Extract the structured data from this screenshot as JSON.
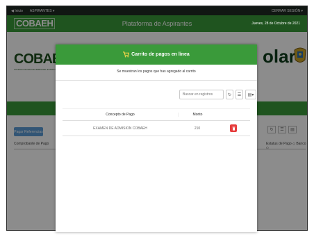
{
  "topbar": {
    "left_label": "◀ Inicio",
    "user_label": "ASPIRANTES ▾",
    "right_label": "CERRAR SESIÓN ▾"
  },
  "header": {
    "logo": "COBAEH",
    "title": "Plataforma de Aspirantes",
    "date": "Jueves, 28 de Octubre de 2021"
  },
  "banner": {
    "logo": "COBAEH",
    "logo_sub": "COLEGIO DE BACHILLERES DEL ESTADO DE HIDALGO",
    "right_text": "olar"
  },
  "background_page": {
    "pay_button": "Pagar Referencias",
    "column_left": "Comprobante de Pago",
    "column_right": "Estatus de Pago  ◇  Banco  ◇"
  },
  "modal": {
    "title": "Carrito de pagos en línea",
    "subtitle": "Se muestran los pagos que has agregado al carrito",
    "search_placeholder": "Buscar en registros",
    "columns": [
      "Concepto de Pago",
      "Monto"
    ],
    "rows": [
      {
        "concept": "EXAMEN DE ADMISION COBAEH",
        "amount": "210"
      }
    ]
  },
  "colors": {
    "brand_green": "#3a9a3a",
    "delete_red": "#e63c3c",
    "pay_blue": "#5b9bd5"
  }
}
